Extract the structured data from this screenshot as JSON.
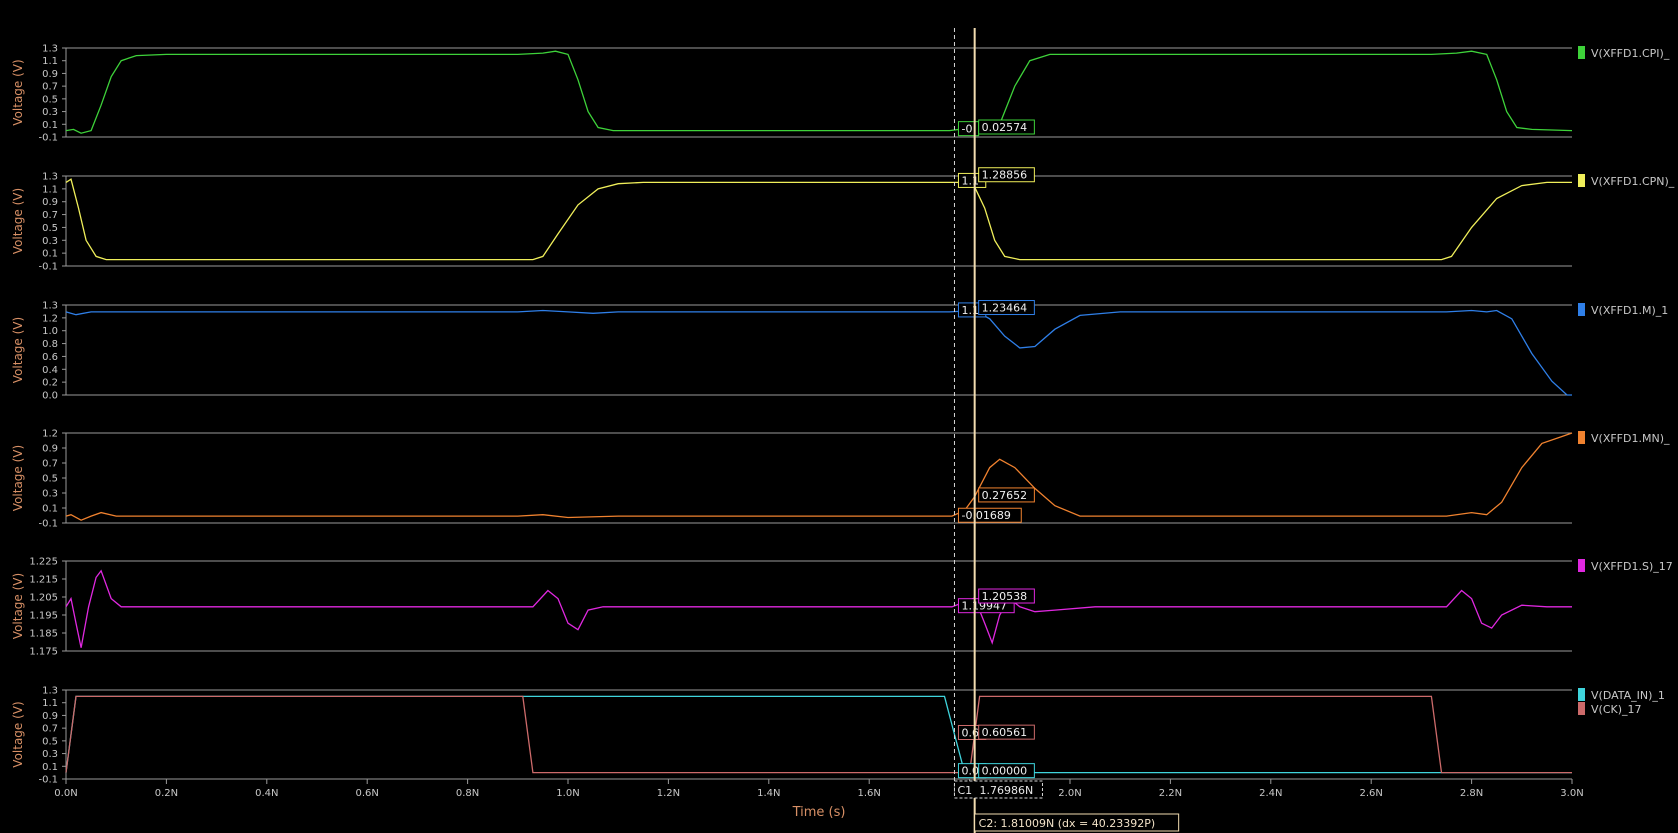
{
  "x_axis": {
    "label": "Time (s)",
    "ticks": [
      "0.0N",
      "0.2N",
      "0.4N",
      "0.6N",
      "0.8N",
      "1.0N",
      "1.2N",
      "1.4N",
      "1.6N",
      "1.8N",
      "2.0N",
      "2.2N",
      "2.4N",
      "2.6N",
      "2.8N",
      "3.0N"
    ],
    "range": [
      0,
      3.0
    ]
  },
  "cursors": {
    "c1": {
      "time": 1.76986,
      "label": "C1",
      "readout": "1.76986N"
    },
    "c2": {
      "time": 1.81009,
      "readout": "C2: 1.81009N (dx = 40.23392P)"
    }
  },
  "colors": {
    "cursor_c2": "#f2dcb0",
    "cursor_c1": "#d6d6d6",
    "ylabel": "#d89066",
    "tick": "#c8c8c8",
    "frame": "#9a9a9a"
  },
  "chart_data": [
    {
      "type": "line",
      "ylabel": "Voltage (V)",
      "yticks": [
        "1.3",
        "1.1",
        "0.9",
        "0.7",
        "0.5",
        "0.3",
        "0.1",
        "-0.1"
      ],
      "ylim": [
        -0.1,
        1.3
      ],
      "series": [
        {
          "name": "V(XFFD1.CPI)_",
          "color": "#3ed23a",
          "points": [
            [
              0.0,
              0.0
            ],
            [
              0.015,
              0.02
            ],
            [
              0.03,
              -0.04
            ],
            [
              0.05,
              0.0
            ],
            [
              0.07,
              0.4
            ],
            [
              0.09,
              0.85
            ],
            [
              0.11,
              1.1
            ],
            [
              0.14,
              1.18
            ],
            [
              0.2,
              1.2
            ],
            [
              0.9,
              1.2
            ],
            [
              0.95,
              1.22
            ],
            [
              0.975,
              1.25
            ],
            [
              1.0,
              1.2
            ],
            [
              1.02,
              0.8
            ],
            [
              1.04,
              0.3
            ],
            [
              1.06,
              0.05
            ],
            [
              1.09,
              0.0
            ],
            [
              1.76,
              0.0
            ],
            [
              1.79,
              0.03
            ],
            [
              1.8,
              0.0
            ],
            [
              1.815,
              0.03
            ],
            [
              1.84,
              -0.05
            ],
            [
              1.86,
              0.1
            ],
            [
              1.89,
              0.7
            ],
            [
              1.92,
              1.1
            ],
            [
              1.96,
              1.2
            ],
            [
              2.0,
              1.2
            ],
            [
              2.72,
              1.2
            ],
            [
              2.77,
              1.22
            ],
            [
              2.8,
              1.25
            ],
            [
              2.83,
              1.2
            ],
            [
              2.85,
              0.8
            ],
            [
              2.87,
              0.3
            ],
            [
              2.89,
              0.05
            ],
            [
              2.92,
              0.02
            ],
            [
              3.0,
              0.0
            ]
          ]
        }
      ],
      "markers": [
        {
          "time": 1.76986,
          "value": -0.0,
          "readout": "-0"
        },
        {
          "time": 1.81009,
          "value": 0.02574,
          "readout": "0.02574"
        }
      ]
    },
    {
      "type": "line",
      "ylabel": "Voltage (V)",
      "yticks": [
        "1.3",
        "1.1",
        "0.9",
        "0.7",
        "0.5",
        "0.3",
        "0.1",
        "-0.1"
      ],
      "ylim": [
        -0.1,
        1.3
      ],
      "series": [
        {
          "name": "V(XFFD1.CPN)_",
          "color": "#f0ef5a",
          "points": [
            [
              0.0,
              1.2
            ],
            [
              0.01,
              1.25
            ],
            [
              0.025,
              0.8
            ],
            [
              0.04,
              0.3
            ],
            [
              0.06,
              0.05
            ],
            [
              0.08,
              0.0
            ],
            [
              0.15,
              0.0
            ],
            [
              0.93,
              0.0
            ],
            [
              0.95,
              0.05
            ],
            [
              0.98,
              0.4
            ],
            [
              1.02,
              0.85
            ],
            [
              1.06,
              1.1
            ],
            [
              1.1,
              1.18
            ],
            [
              1.15,
              1.2
            ],
            [
              1.765,
              1.2
            ],
            [
              1.79,
              1.2
            ],
            [
              1.81,
              1.13
            ],
            [
              1.83,
              0.8
            ],
            [
              1.85,
              0.3
            ],
            [
              1.87,
              0.05
            ],
            [
              1.9,
              0.0
            ],
            [
              2.74,
              0.0
            ],
            [
              2.76,
              0.05
            ],
            [
              2.8,
              0.5
            ],
            [
              2.85,
              0.95
            ],
            [
              2.9,
              1.15
            ],
            [
              2.95,
              1.2
            ],
            [
              3.0,
              1.2
            ]
          ]
        }
      ],
      "markers": [
        {
          "time": 1.76986,
          "value": 1.2,
          "readout": "1.1"
        },
        {
          "time": 1.81009,
          "value": 1.28856,
          "readout": "1.28856"
        }
      ]
    },
    {
      "type": "line",
      "ylabel": "Voltage (V)",
      "yticks": [
        "1.3",
        "1.2",
        "1.0",
        "0.8",
        "0.6",
        "0.4",
        "0.2",
        "0.0"
      ],
      "ylim": [
        0.0,
        1.3
      ],
      "series": [
        {
          "name": "V(XFFD1.M)_1",
          "color": "#2f7fe8",
          "points": [
            [
              0.0,
              1.2
            ],
            [
              0.02,
              1.16
            ],
            [
              0.05,
              1.2
            ],
            [
              0.1,
              1.2
            ],
            [
              0.9,
              1.2
            ],
            [
              0.95,
              1.22
            ],
            [
              1.0,
              1.2
            ],
            [
              1.05,
              1.18
            ],
            [
              1.1,
              1.2
            ],
            [
              1.76,
              1.2
            ],
            [
              1.81,
              1.22
            ],
            [
              1.84,
              1.1
            ],
            [
              1.87,
              0.85
            ],
            [
              1.9,
              0.68
            ],
            [
              1.93,
              0.7
            ],
            [
              1.97,
              0.95
            ],
            [
              2.02,
              1.15
            ],
            [
              2.1,
              1.2
            ],
            [
              2.75,
              1.2
            ],
            [
              2.8,
              1.22
            ],
            [
              2.83,
              1.2
            ],
            [
              2.85,
              1.22
            ],
            [
              2.88,
              1.1
            ],
            [
              2.92,
              0.6
            ],
            [
              2.96,
              0.2
            ],
            [
              2.99,
              0.0
            ],
            [
              3.0,
              0.0
            ]
          ]
        }
      ],
      "markers": [
        {
          "time": 1.76986,
          "value": 1.2,
          "readout": "1.1"
        },
        {
          "time": 1.81009,
          "value": 1.23464,
          "readout": "1.23464"
        }
      ]
    },
    {
      "type": "line",
      "ylabel": "Voltage (V)",
      "yticks": [
        "1.2",
        "0.9",
        "0.7",
        "0.5",
        "0.3",
        "0.1",
        "-0.1"
      ],
      "ylim": [
        -0.1,
        1.2
      ],
      "series": [
        {
          "name": "V(XFFD1.MN)_",
          "color": "#f0822f",
          "points": [
            [
              0.0,
              0.0
            ],
            [
              0.01,
              0.02
            ],
            [
              0.03,
              -0.06
            ],
            [
              0.05,
              0.0
            ],
            [
              0.07,
              0.05
            ],
            [
              0.1,
              0.0
            ],
            [
              0.9,
              0.0
            ],
            [
              0.95,
              0.02
            ],
            [
              1.0,
              -0.02
            ],
            [
              1.1,
              0.0
            ],
            [
              1.765,
              0.0
            ],
            [
              1.79,
              0.08
            ],
            [
              1.81,
              0.28
            ],
            [
              1.84,
              0.7
            ],
            [
              1.86,
              0.82
            ],
            [
              1.89,
              0.7
            ],
            [
              1.93,
              0.4
            ],
            [
              1.97,
              0.15
            ],
            [
              2.02,
              0.0
            ],
            [
              2.75,
              0.0
            ],
            [
              2.8,
              0.05
            ],
            [
              2.83,
              0.02
            ],
            [
              2.86,
              0.2
            ],
            [
              2.9,
              0.7
            ],
            [
              2.94,
              1.05
            ],
            [
              2.98,
              1.15
            ],
            [
              3.0,
              1.2
            ]
          ]
        }
      ],
      "markers": [
        {
          "time": 1.76986,
          "value": -0.01689,
          "readout": "-0.01689"
        },
        {
          "time": 1.81009,
          "value": 0.27652,
          "readout": "0.27652"
        }
      ]
    },
    {
      "type": "line",
      "ylabel": "Voltage (V)",
      "yticks": [
        "1.225",
        "1.215",
        "1.205",
        "1.195",
        "1.185",
        "1.175"
      ],
      "ylim": [
        1.173,
        1.228
      ],
      "series": [
        {
          "name": "V(XFFD1.S)_17",
          "color": "#e028e0",
          "points": [
            [
              0.0,
              1.2
            ],
            [
              0.01,
              1.205
            ],
            [
              0.02,
              1.19
            ],
            [
              0.03,
              1.175
            ],
            [
              0.045,
              1.2
            ],
            [
              0.06,
              1.218
            ],
            [
              0.07,
              1.222
            ],
            [
              0.09,
              1.205
            ],
            [
              0.11,
              1.2
            ],
            [
              0.15,
              1.2
            ],
            [
              0.93,
              1.2
            ],
            [
              0.96,
              1.21
            ],
            [
              0.98,
              1.205
            ],
            [
              1.0,
              1.19
            ],
            [
              1.02,
              1.186
            ],
            [
              1.04,
              1.198
            ],
            [
              1.07,
              1.2
            ],
            [
              1.765,
              1.2
            ],
            [
              1.79,
              1.203
            ],
            [
              1.81,
              1.2054
            ],
            [
              1.83,
              1.19
            ],
            [
              1.845,
              1.178
            ],
            [
              1.86,
              1.195
            ],
            [
              1.88,
              1.205
            ],
            [
              1.9,
              1.2
            ],
            [
              1.93,
              1.197
            ],
            [
              1.97,
              1.198
            ],
            [
              2.05,
              1.2
            ],
            [
              2.75,
              1.2
            ],
            [
              2.78,
              1.21
            ],
            [
              2.8,
              1.205
            ],
            [
              2.82,
              1.19
            ],
            [
              2.84,
              1.187
            ],
            [
              2.86,
              1.195
            ],
            [
              2.9,
              1.201
            ],
            [
              2.95,
              1.2
            ],
            [
              3.0,
              1.2
            ]
          ]
        }
      ],
      "markers": [
        {
          "time": 1.76986,
          "value": 1.19947,
          "readout": "1.19947"
        },
        {
          "time": 1.81009,
          "value": 1.20538,
          "readout": "1.20538"
        }
      ]
    },
    {
      "type": "line",
      "ylabel": "Voltage (V)",
      "yticks": [
        "1.3",
        "1.1",
        "0.9",
        "0.7",
        "0.5",
        "0.3",
        "0.1",
        "-0.1"
      ],
      "ylim": [
        -0.1,
        1.3
      ],
      "series": [
        {
          "name": "V(DATA_IN)_1",
          "color": "#3fd4dc",
          "points": [
            [
              0.0,
              0.0
            ],
            [
              0.02,
              1.2
            ],
            [
              1.75,
              1.2
            ],
            [
              1.77,
              0.6
            ],
            [
              1.79,
              0.0
            ],
            [
              3.0,
              0.0
            ]
          ]
        },
        {
          "name": "V(CK)_17",
          "color": "#cc6a6a",
          "points": [
            [
              0.0,
              0.0
            ],
            [
              0.02,
              1.2
            ],
            [
              0.91,
              1.2
            ],
            [
              0.93,
              0.0
            ],
            [
              1.8,
              0.0
            ],
            [
              1.82,
              1.2
            ],
            [
              2.72,
              1.2
            ],
            [
              2.74,
              0.0
            ],
            [
              3.0,
              0.0
            ]
          ]
        }
      ],
      "markers": [
        {
          "time": 1.76986,
          "value": 0.6,
          "readout": "0.6"
        },
        {
          "time": 1.81009,
          "value": 0.60561,
          "readout": "0.60561"
        },
        {
          "time": 1.76986,
          "value": 0.0,
          "readout": "0.0"
        },
        {
          "time": 1.81009,
          "value": 0.0,
          "readout": "0.00000"
        }
      ]
    }
  ]
}
